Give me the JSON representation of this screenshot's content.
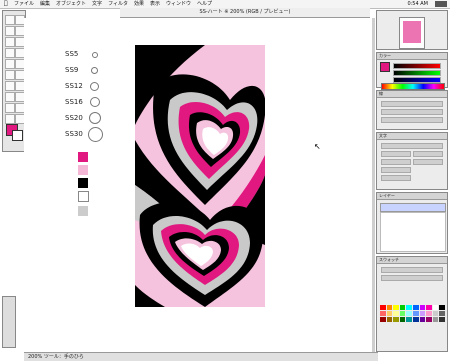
{
  "menubar": {
    "items": [
      "ファイル",
      "編集",
      "オブジェクト",
      "文字",
      "フィルタ",
      "効果",
      "表示",
      "ウィンドウ",
      "ヘルプ"
    ],
    "time": "0:54 AM"
  },
  "document": {
    "title": "SS-ハート ※ 200% (RGB / プレビュー)"
  },
  "sizes": [
    {
      "label": "SS5"
    },
    {
      "label": "SS9"
    },
    {
      "label": "SS12"
    },
    {
      "label": "SS16"
    },
    {
      "label": "SS20"
    },
    {
      "label": "SS30"
    }
  ],
  "swatches": [
    "#e0187f",
    "#f4b8d6",
    "#000000",
    "#ffffff",
    "#cccccc"
  ],
  "status": {
    "zoom": "200%",
    "info": "ツール：手のひら"
  },
  "panels": {
    "color": "カラー",
    "stroke": "線",
    "transparency": "透明",
    "character": "文字",
    "layers": "レイヤー",
    "swatches": "スウォッチ"
  },
  "palette_colors": [
    "#ff0000",
    "#ff8800",
    "#ffff00",
    "#00cc00",
    "#00ffff",
    "#0066ff",
    "#cc00ff",
    "#ff00aa",
    "#ffffff",
    "#000000",
    "#ff6666",
    "#ffcc66",
    "#ffff99",
    "#66ff66",
    "#99ffff",
    "#6699ff",
    "#cc99ff",
    "#ff99cc",
    "#cccccc",
    "#666666",
    "#990000",
    "#996600",
    "#999900",
    "#006600",
    "#009999",
    "#003399",
    "#660099",
    "#990066",
    "#999999",
    "#333333"
  ]
}
